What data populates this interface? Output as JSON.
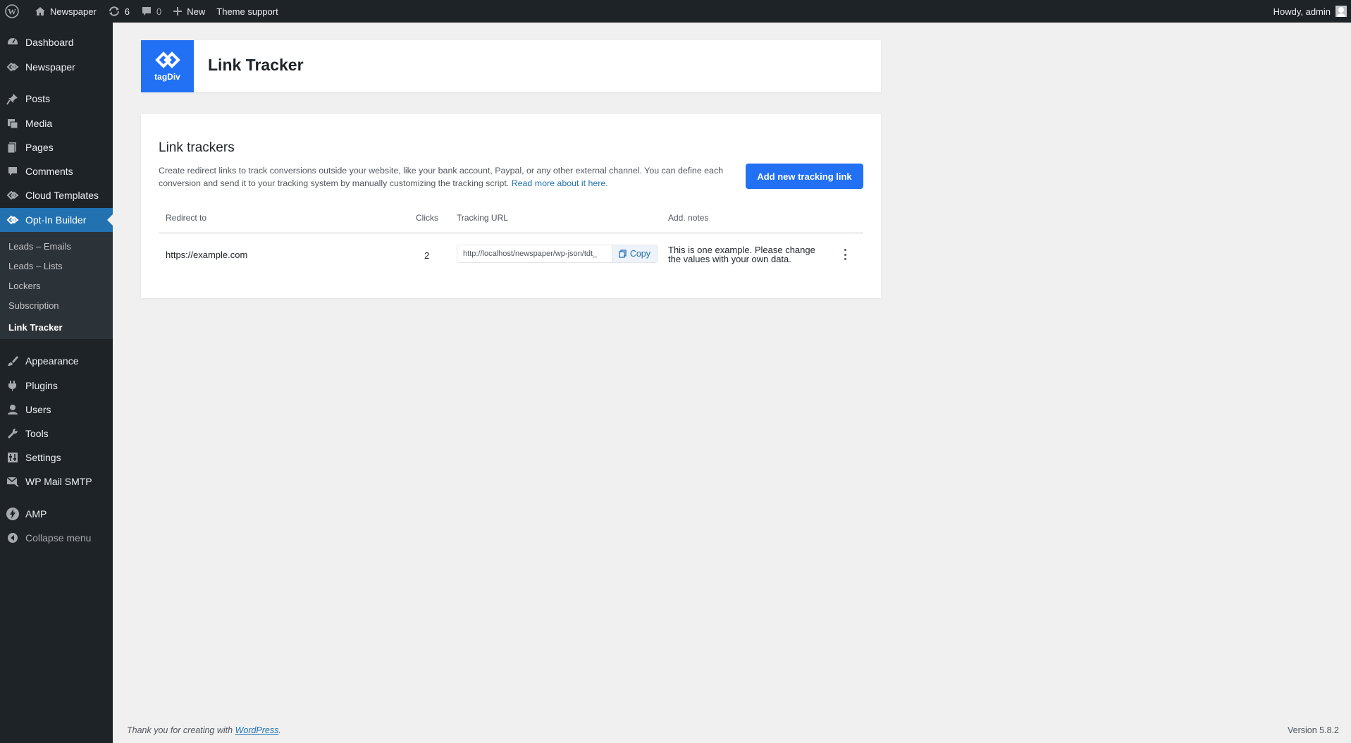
{
  "adminbar": {
    "site_name": "Newspaper",
    "updates_count": "6",
    "comments_count": "0",
    "new_label": "New",
    "theme_support_label": "Theme support",
    "howdy": "Howdy, admin"
  },
  "sidebar": {
    "items": [
      {
        "label": "Dashboard",
        "icon": "dashboard-icon"
      },
      {
        "label": "Newspaper",
        "icon": "tagdiv-icon"
      },
      {
        "label": "Posts",
        "icon": "pin-icon"
      },
      {
        "label": "Media",
        "icon": "media-icon"
      },
      {
        "label": "Pages",
        "icon": "pages-icon"
      },
      {
        "label": "Comments",
        "icon": "comment-icon"
      },
      {
        "label": "Cloud Templates",
        "icon": "tagdiv-icon"
      },
      {
        "label": "Opt-In Builder",
        "icon": "tagdiv-icon"
      },
      {
        "label": "Appearance",
        "icon": "brush-icon"
      },
      {
        "label": "Plugins",
        "icon": "plug-icon"
      },
      {
        "label": "Users",
        "icon": "user-icon"
      },
      {
        "label": "Tools",
        "icon": "wrench-icon"
      },
      {
        "label": "Settings",
        "icon": "settings-icon"
      },
      {
        "label": "WP Mail SMTP",
        "icon": "mail-icon"
      },
      {
        "label": "AMP",
        "icon": "amp-icon"
      },
      {
        "label": "Collapse menu",
        "icon": "collapse-icon"
      }
    ],
    "submenu": [
      {
        "label": "Leads – Emails"
      },
      {
        "label": "Leads – Lists"
      },
      {
        "label": "Lockers"
      },
      {
        "label": "Subscription"
      },
      {
        "label": "Link Tracker"
      }
    ]
  },
  "header": {
    "logo_text": "tagDiv",
    "title": "Link Tracker"
  },
  "main": {
    "section_title": "Link trackers",
    "description": "Create redirect links to track conversions outside your website, like your bank account, Paypal, or any other external channel. You can define each conversion and send it to your tracking system by manually customizing the tracking script.",
    "read_more": "Read more about it here.",
    "add_button": "Add new tracking link",
    "columns": {
      "redirect": "Redirect to",
      "clicks": "Clicks",
      "tracking_url": "Tracking URL",
      "notes": "Add. notes"
    },
    "rows": [
      {
        "redirect": "https://example.com",
        "clicks": "2",
        "tracking_url": "http://localhost/newspaper/wp-json/tdt_",
        "copy_label": "Copy",
        "notes": "This is one example. Please change the values with your own data."
      }
    ]
  },
  "footer": {
    "thanks_prefix": "Thank you for creating with",
    "wordpress_link": "WordPress",
    "thanks_suffix": ".",
    "version": "Version 5.8.2"
  },
  "colors": {
    "accent": "#2271f5",
    "sidebar_bg": "#1d2327",
    "active_bg": "#2271b1"
  }
}
